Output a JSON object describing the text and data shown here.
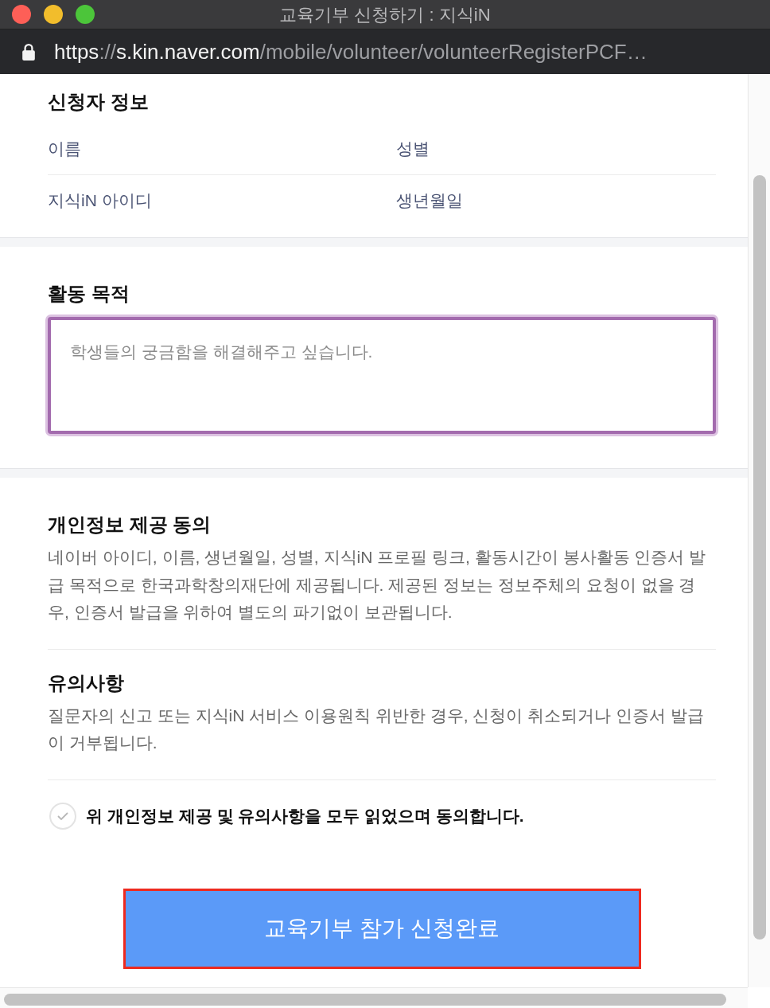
{
  "window": {
    "title": "교육기부 신청하기 : 지식iN"
  },
  "address_bar": {
    "secure": true,
    "url_parts": [
      {
        "text": "https",
        "dim": false
      },
      {
        "text": "://",
        "dim": true
      },
      {
        "text": "s.kin.naver.com",
        "dim": false
      },
      {
        "text": "/mobile/volunteer/volunteerRegisterPCF…",
        "dim": true
      }
    ]
  },
  "applicant_info": {
    "title": "신청자 정보",
    "rows": [
      {
        "cells": [
          "이름",
          "성별"
        ]
      },
      {
        "cells": [
          "지식iN 아이디",
          "생년월일"
        ]
      }
    ]
  },
  "activity_purpose": {
    "title": "활동 목적",
    "textarea": {
      "placeholder": "학생들의 궁금함을 해결해주고 싶습니다.",
      "focused": true
    }
  },
  "sections": [
    {
      "title": "개인정보 제공 동의",
      "text": "네이버 아이디, 이름, 생년월일, 성별, 지식iN 프로필 링크, 활동시간이 봉사활동 인증서 발급 목적으로 한국과학창의재단에 제공됩니다. 제공된 정보는 정보주체의 요청이 없을 경우, 인증서 발급을 위하여 별도의 파기없이 보관됩니다."
    },
    {
      "title": "유의사항",
      "text": "질문자의 신고 또는 지식iN 서비스 이용원칙 위반한 경우, 신청이 취소되거나 인증서 발급이 거부됩니다."
    }
  ],
  "agreement": {
    "label": "위 개인정보 제공 및 유의사항을 모두 읽었으며 동의합니다.",
    "checked": false
  },
  "submit_button": {
    "label": "교육기부 참가 신청완료",
    "highlighted": true
  }
}
